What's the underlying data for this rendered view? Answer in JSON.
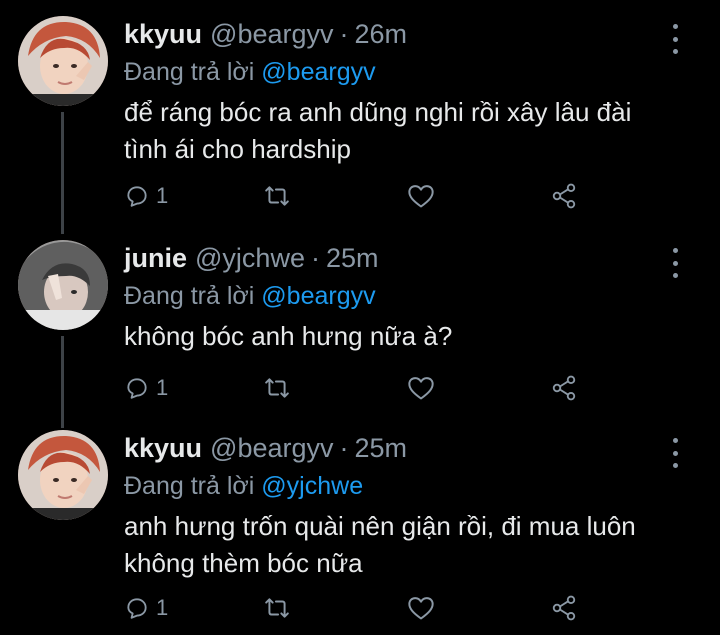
{
  "colors": {
    "background": "#000000",
    "text": "#e7e9ea",
    "muted": "#8b98a5",
    "link": "#1d9bf0",
    "thread_line": "#3d4247"
  },
  "replying_prefix": "Đang trả lời",
  "tweets": [
    {
      "name": "kkyuu",
      "handle": "@beargyv",
      "separator": "·",
      "time": "26m",
      "reply_to": "@beargyv",
      "text_lines": [
        "để ráng bóc ra anh dũng nghi rồi xây lâu đài",
        "tình ái cho hardship"
      ],
      "reply_count": "1",
      "icons": [
        "reply-icon",
        "retweet-icon",
        "like-icon",
        "share-icon",
        "more-icon"
      ]
    },
    {
      "name": "junie",
      "handle": "@yjchwe",
      "separator": "·",
      "time": "25m",
      "reply_to": "@beargyv",
      "text_lines": [
        "không bóc anh hưng nữa à?"
      ],
      "reply_count": "1",
      "icons": [
        "reply-icon",
        "retweet-icon",
        "like-icon",
        "share-icon",
        "more-icon"
      ]
    },
    {
      "name": "kkyuu",
      "handle": "@beargyv",
      "separator": "·",
      "time": "25m",
      "reply_to": "@yjchwe",
      "text_lines": [
        "anh hưng trốn quài nên giận rồi, đi mua luôn",
        "không thèm bóc nữa"
      ],
      "reply_count": "1",
      "icons": [
        "reply-icon",
        "retweet-icon",
        "like-icon",
        "share-icon",
        "more-icon"
      ]
    }
  ]
}
